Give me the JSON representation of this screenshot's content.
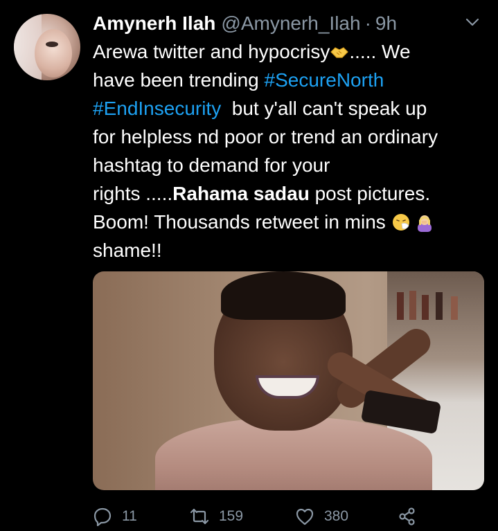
{
  "tweet": {
    "author_name": "Amynerh Ilah",
    "handle": "@Amynerh_Ilah",
    "separator": "·",
    "time": "9h",
    "lines": [
      {
        "a": "Arewa twitter and hypocrisy",
        "b": "..... We"
      },
      {
        "a": "have been trending ",
        "hashtag": "#SecureNorth"
      },
      {
        "hashtag": "#EndInsecurity",
        "b": "  but y'all can't speak up"
      },
      {
        "a": "for helpless nd poor or trend an ordinary"
      },
      {
        "a": "hashtag to demand for your"
      },
      {
        "a": "rights .....",
        "bold": "Rahama sadau",
        "b": " post pictures."
      },
      {
        "a": "Boom! Thousands retweet in mins "
      },
      {
        "a": "shame!!"
      }
    ],
    "emojis": [
      "handshake-emoji",
      "sneezing-face-emoji",
      "woman-facepalming-emoji"
    ]
  },
  "actions": {
    "reply_count": "11",
    "retweet_count": "159",
    "like_count": "380"
  },
  "colors": {
    "background": "#000000",
    "text": "#ffffff",
    "muted": "#8b98a5",
    "link": "#1da1f2"
  },
  "icons": [
    "chevron-down-icon",
    "reply-icon",
    "retweet-icon",
    "like-icon",
    "share-icon"
  ]
}
